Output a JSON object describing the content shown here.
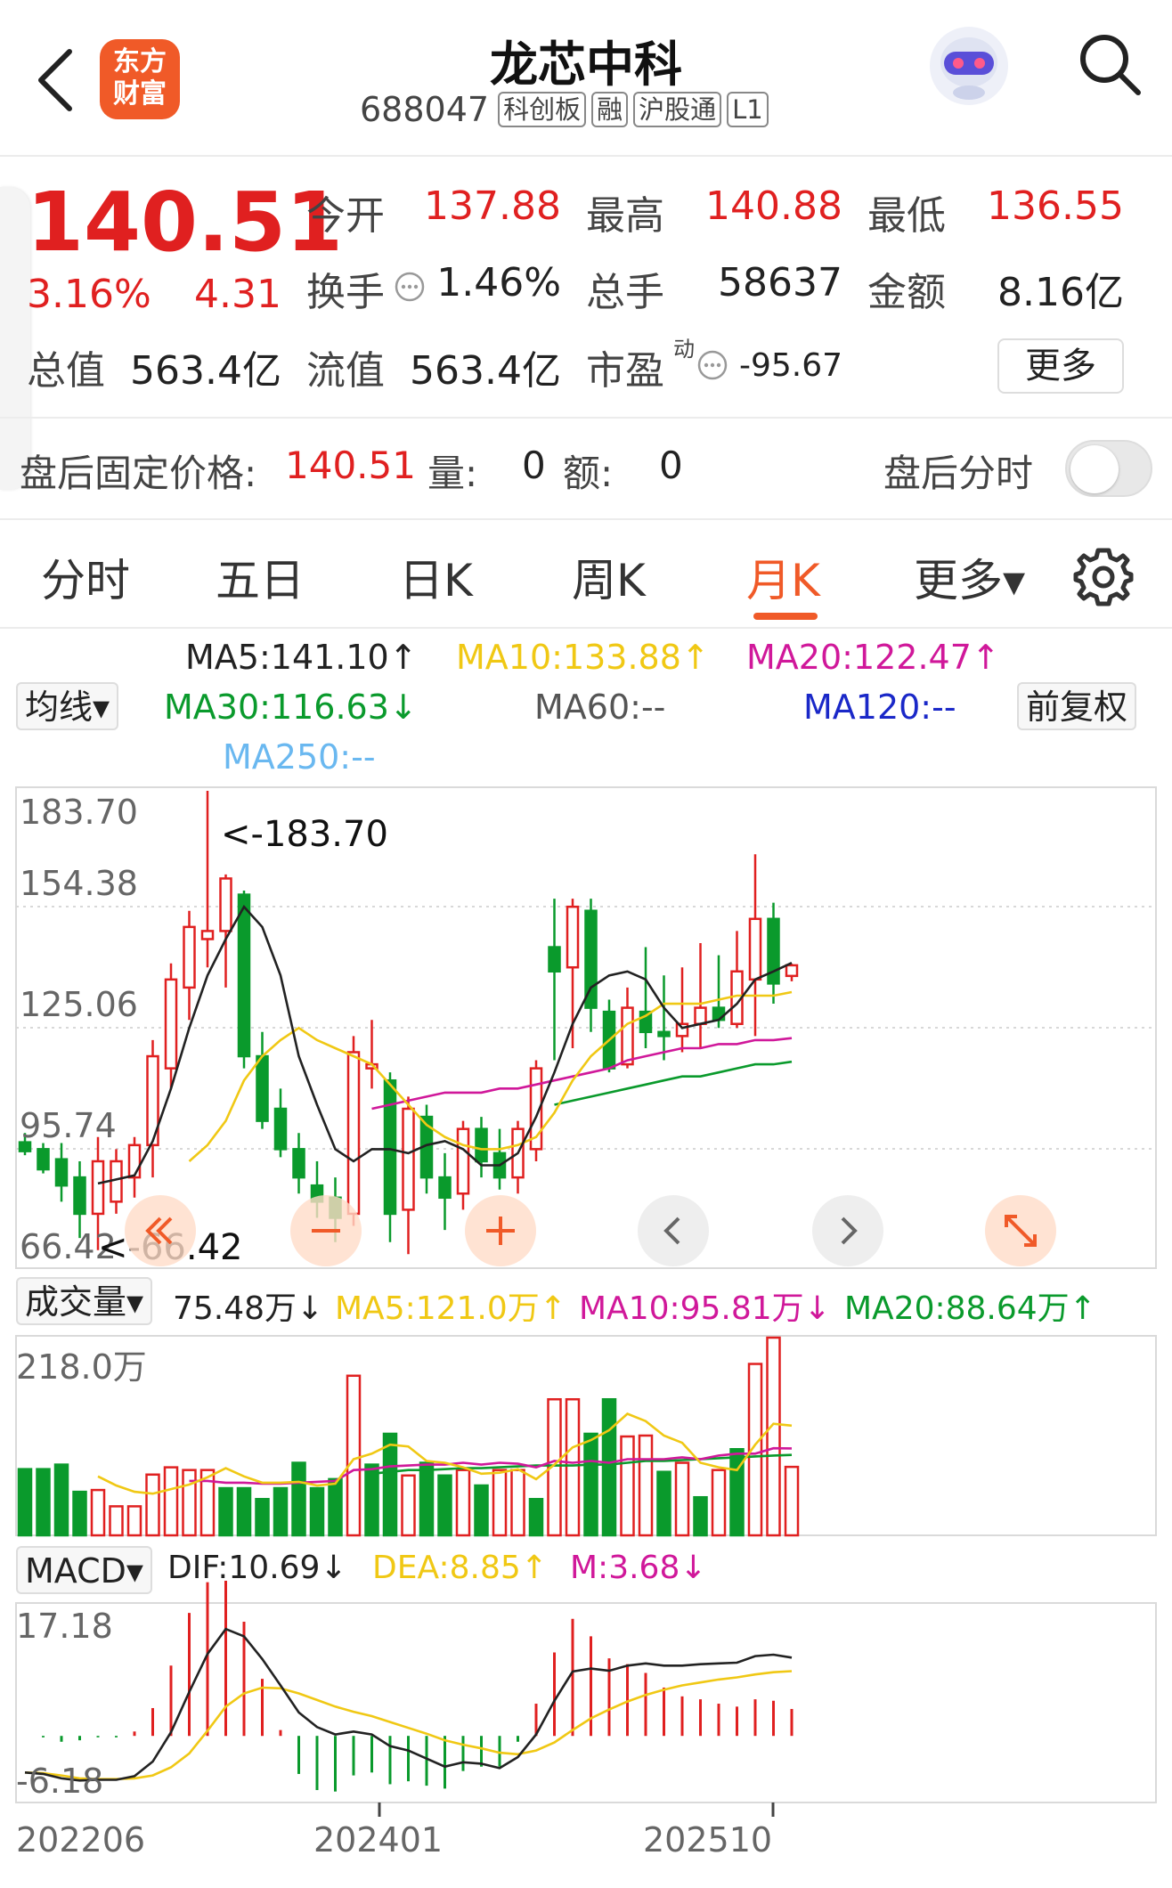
{
  "header": {
    "title": "龙芯中科",
    "code": "688047",
    "tags": [
      "科创板",
      "融",
      "沪股通",
      "L1"
    ],
    "logo_text": [
      "东方",
      "财富"
    ]
  },
  "quote": {
    "price": "140.51",
    "change_pct": "3.16%",
    "change": "4.31",
    "open_label": "今开",
    "open": "137.88",
    "high_label": "最高",
    "high": "140.88",
    "low_label": "最低",
    "low": "136.55",
    "turnover_label": "换手",
    "turnover": "1.46%",
    "volume_label": "总手",
    "volume": "58637",
    "amount_label": "金额",
    "amount": "8.16亿",
    "mktcap_label": "总值",
    "mktcap": "563.4亿",
    "float_label": "流值",
    "float_cap": "563.4亿",
    "pe_label": "市盈",
    "pe_sup": "动",
    "pe": "-95.67",
    "more_label": "更多"
  },
  "after_hours": {
    "label": "盘后固定价格:",
    "price": "140.51",
    "vol_label": "量:",
    "vol": "0",
    "amt_label": "额:",
    "amt": "0",
    "toggle_label": "盘后分时",
    "toggle_on": false
  },
  "tabs": [
    "分时",
    "五日",
    "日K",
    "周K",
    "月K",
    "更多▾"
  ],
  "active_tab": "月K",
  "ma_legend": {
    "ma5": "MA5:141.10↑",
    "ma10": "MA10:133.88↑",
    "ma20": "MA20:122.47↑",
    "ma30": "MA30:116.63↓",
    "ma60": "MA60:--",
    "ma120": "MA120:--",
    "ma250": "MA250:--",
    "ma_select": "均线▾",
    "adjust": "前复权"
  },
  "colors": {
    "up": "#e02020",
    "down": "#0a9a2c",
    "ma5": "#222222",
    "ma10": "#f0c814",
    "ma20": "#d0189a",
    "ma30": "#0a9a2c",
    "ma120": "#1a28c8",
    "ma250": "#6ab8f0",
    "accent": "#f05a28"
  },
  "price_axis": {
    "ticks": [
      "183.70",
      "154.38",
      "125.06",
      "95.74",
      "66.42"
    ],
    "max_marker": "<-183.70",
    "min_marker": "<-66.42"
  },
  "volume_panel": {
    "select": "成交量▾",
    "current": "75.48万↓",
    "ma5": "MA5:121.0万↑",
    "ma10": "MA10:95.81万↓",
    "ma20": "MA20:88.64万↑",
    "axis_max": "218.0万"
  },
  "macd_panel": {
    "select": "MACD▾",
    "dif": "DIF:10.69↓",
    "dea": "DEA:8.85↑",
    "m": "M:3.68↓",
    "axis_max": "17.18",
    "axis_min": "-6.18"
  },
  "x_axis": [
    "202206",
    "202401",
    "202510"
  ],
  "chart_data": {
    "type": "candlestick",
    "period": "monthly",
    "ylim": [
      66.42,
      183.7
    ],
    "candles": [
      {
        "o": 96.7,
        "h": 99,
        "l": 93.5,
        "c": 94.5
      },
      {
        "o": 95,
        "h": 96.5,
        "l": 89,
        "c": 90
      },
      {
        "o": 92.5,
        "h": 96.5,
        "l": 82,
        "c": 86
      },
      {
        "o": 88,
        "h": 92,
        "l": 73,
        "c": 79
      },
      {
        "o": 79,
        "h": 98,
        "l": 70,
        "c": 92
      },
      {
        "o": 82,
        "h": 95,
        "l": 79,
        "c": 92
      },
      {
        "o": 88,
        "h": 98,
        "l": 83,
        "c": 96
      },
      {
        "o": 96,
        "h": 122,
        "l": 88,
        "c": 118
      },
      {
        "o": 115,
        "h": 141,
        "l": 110,
        "c": 137
      },
      {
        "o": 135,
        "h": 154,
        "l": 127,
        "c": 150
      },
      {
        "o": 147,
        "h": 183.7,
        "l": 140,
        "c": 149
      },
      {
        "o": 149,
        "h": 163,
        "l": 135,
        "c": 162
      },
      {
        "o": 158,
        "h": 159,
        "l": 115,
        "c": 118
      },
      {
        "o": 118,
        "h": 124,
        "l": 100,
        "c": 102
      },
      {
        "o": 105,
        "h": 110,
        "l": 93,
        "c": 95
      },
      {
        "o": 95,
        "h": 99,
        "l": 84,
        "c": 88
      },
      {
        "o": 86,
        "h": 92,
        "l": 78,
        "c": 82
      },
      {
        "o": 83,
        "h": 88,
        "l": 72,
        "c": 78
      },
      {
        "o": 79,
        "h": 123,
        "l": 76,
        "c": 119
      },
      {
        "o": 115,
        "h": 127,
        "l": 110,
        "c": 116
      },
      {
        "o": 112,
        "h": 114,
        "l": 72,
        "c": 79
      },
      {
        "o": 80,
        "h": 108,
        "l": 69,
        "c": 105
      },
      {
        "o": 103,
        "h": 106,
        "l": 84,
        "c": 88
      },
      {
        "o": 88,
        "h": 94,
        "l": 75,
        "c": 83
      },
      {
        "o": 84,
        "h": 102,
        "l": 80,
        "c": 100
      },
      {
        "o": 100,
        "h": 103,
        "l": 88,
        "c": 92
      },
      {
        "o": 94,
        "h": 100,
        "l": 85,
        "c": 88
      },
      {
        "o": 88,
        "h": 102,
        "l": 84,
        "c": 100
      },
      {
        "o": 95,
        "h": 117,
        "l": 92,
        "c": 115
      },
      {
        "o": 145,
        "h": 157,
        "l": 117,
        "c": 139
      },
      {
        "o": 140,
        "h": 157,
        "l": 120,
        "c": 155
      },
      {
        "o": 154,
        "h": 157,
        "l": 124,
        "c": 130
      },
      {
        "o": 129,
        "h": 132,
        "l": 114,
        "c": 115
      },
      {
        "o": 116,
        "h": 135,
        "l": 115,
        "c": 130
      },
      {
        "o": 129,
        "h": 145,
        "l": 120,
        "c": 124
      },
      {
        "o": 124,
        "h": 138,
        "l": 117,
        "c": 123
      },
      {
        "o": 123,
        "h": 140,
        "l": 119,
        "c": 126
      },
      {
        "o": 126,
        "h": 146,
        "l": 120,
        "c": 130
      },
      {
        "o": 130,
        "h": 143,
        "l": 125,
        "c": 127
      },
      {
        "o": 126,
        "h": 149,
        "l": 125,
        "c": 139
      },
      {
        "o": 137,
        "h": 168,
        "l": 123,
        "c": 152
      },
      {
        "o": 152,
        "h": 156,
        "l": 131,
        "c": 136
      },
      {
        "o": 137.88,
        "h": 140.88,
        "l": 136.55,
        "c": 140.51
      }
    ],
    "ma5": [
      null,
      null,
      null,
      null,
      86.5,
      87.5,
      88.5,
      97,
      110,
      125,
      138,
      147,
      155,
      150,
      138,
      118,
      106,
      95,
      92,
      95,
      95,
      94,
      96,
      97,
      95,
      91,
      91,
      94,
      103,
      114,
      126,
      135,
      138,
      139,
      137,
      130,
      125,
      126,
      127,
      131,
      137,
      139,
      141.1
    ],
    "ma10": [
      null,
      null,
      null,
      null,
      null,
      null,
      null,
      null,
      null,
      92,
      96,
      102,
      112,
      118,
      122,
      125,
      122,
      120,
      118,
      116,
      111,
      106,
      101,
      98,
      96,
      95,
      95,
      96,
      98,
      104,
      112,
      118,
      122,
      126,
      128,
      131,
      131,
      131,
      132,
      133,
      133,
      133,
      133.88
    ],
    "ma20": [
      null,
      null,
      null,
      null,
      null,
      null,
      null,
      null,
      null,
      null,
      null,
      null,
      null,
      null,
      null,
      null,
      null,
      null,
      null,
      105,
      106,
      107,
      108,
      109,
      109,
      109,
      110,
      110,
      111,
      112,
      113,
      114,
      115,
      117,
      118,
      119,
      120,
      120,
      121,
      121,
      122,
      122,
      122.47
    ],
    "ma30": [
      null,
      null,
      null,
      null,
      null,
      null,
      null,
      null,
      null,
      null,
      null,
      null,
      null,
      null,
      null,
      null,
      null,
      null,
      null,
      null,
      null,
      null,
      null,
      null,
      null,
      null,
      null,
      null,
      null,
      106,
      107,
      108,
      109,
      110,
      111,
      112,
      113,
      113,
      114,
      115,
      116,
      116,
      116.63
    ],
    "volume_max": 218.0,
    "volume": [
      73,
      73,
      78,
      48,
      50,
      32,
      32,
      67,
      75,
      72,
      72,
      52,
      52,
      40,
      52,
      80,
      52,
      62,
      176,
      78,
      112,
      66,
      80,
      66,
      72,
      55,
      72,
      72,
      40,
      150,
      150,
      112,
      150,
      109,
      110,
      70,
      80,
      42,
      72,
      95,
      189,
      218,
      75.48
    ],
    "volume_up": [
      false,
      false,
      false,
      false,
      true,
      true,
      true,
      true,
      true,
      true,
      true,
      false,
      false,
      false,
      false,
      false,
      false,
      false,
      true,
      false,
      false,
      true,
      false,
      false,
      true,
      false,
      true,
      true,
      false,
      true,
      true,
      false,
      false,
      true,
      true,
      false,
      true,
      false,
      true,
      false,
      true,
      true,
      true
    ],
    "vol_ma5": [
      null,
      null,
      null,
      null,
      65,
      55,
      48,
      46,
      51,
      56,
      64,
      74,
      65,
      58,
      58,
      59,
      55,
      57,
      84,
      90,
      100,
      98,
      82,
      80,
      75,
      68,
      69,
      73,
      62,
      78,
      97,
      105,
      116,
      134,
      126,
      110,
      102,
      80,
      75,
      72,
      100,
      123,
      121.0
    ],
    "vol_ma10": [
      null,
      null,
      null,
      null,
      null,
      null,
      null,
      null,
      null,
      60,
      60,
      58,
      58,
      57,
      57,
      58,
      59,
      60,
      72,
      73,
      76,
      77,
      78,
      78,
      80,
      78,
      80,
      79,
      75,
      82,
      80,
      82,
      80,
      84,
      84,
      84,
      86,
      84,
      88,
      90,
      90,
      96,
      95.81
    ],
    "vol_ma20": [
      null,
      null,
      null,
      null,
      null,
      null,
      null,
      null,
      null,
      null,
      null,
      null,
      null,
      null,
      null,
      null,
      null,
      null,
      null,
      68,
      70,
      72,
      72,
      73,
      74,
      74,
      75,
      76,
      77,
      77,
      77,
      78,
      78,
      80,
      82,
      82,
      83,
      84,
      85,
      86,
      87,
      88,
      88.64
    ],
    "macd_range": [
      -6.18,
      17.18
    ],
    "dif": [
      -5,
      -5.2,
      -5.8,
      -6.1,
      -6,
      -6,
      -5.5,
      -3.5,
      0.5,
      6,
      11.2,
      14.6,
      13.6,
      10.5,
      6.9,
      3.2,
      1.2,
      0.2,
      0.6,
      0.2,
      -1.4,
      -2,
      -3.1,
      -4.2,
      -3.6,
      -3.8,
      -4.4,
      -2.9,
      0.2,
      4.8,
      8.8,
      9.2,
      8.9,
      9.6,
      9.9,
      9.6,
      9.6,
      9.8,
      9.9,
      10.0,
      10.9,
      11.1,
      10.69
    ],
    "dea": [
      -5,
      -5.1,
      -5.4,
      -5.8,
      -5.9,
      -5.9,
      -5.8,
      -5.4,
      -4.3,
      -2.4,
      0.7,
      4,
      5.8,
      6.6,
      6.5,
      5.8,
      4.9,
      4,
      3.3,
      2.7,
      1.9,
      1.1,
      0.3,
      -0.6,
      -1.2,
      -1.7,
      -2.3,
      -2.5,
      -2,
      -0.9,
      0.8,
      2.4,
      3.6,
      4.7,
      5.6,
      6.3,
      6.9,
      7.3,
      7.7,
      8,
      8.4,
      8.7,
      8.85
    ]
  }
}
